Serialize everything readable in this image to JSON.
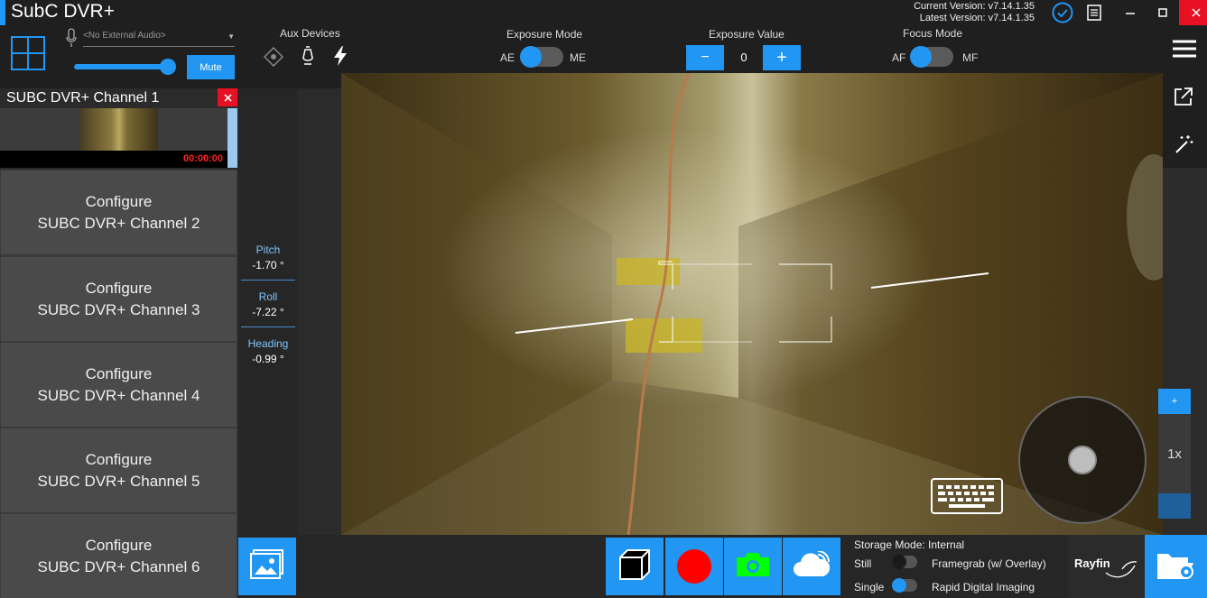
{
  "window": {
    "title": "SubC DVR+",
    "current_version": "Current Version: v7.14.1.35",
    "latest_version": "Latest Version: v7.14.1.35"
  },
  "toolbar": {
    "audio_source": "<No External Audio>",
    "mute_label": "Mute",
    "audio_level": 0.95,
    "aux_devices_label": "Aux Devices",
    "exposure_mode_label": "Exposure Mode",
    "exposure_mode_left": "AE",
    "exposure_mode_right": "ME",
    "exposure_value_label": "Exposure Value",
    "exposure_minus": "−",
    "exposure_plus": "+",
    "exposure_value": "0",
    "focus_mode_label": "Focus Mode",
    "focus_mode_left": "AF",
    "focus_mode_right": "MF"
  },
  "channels": {
    "active": {
      "name": "SUBC DVR+ Channel 1",
      "timer": "00:00:00"
    },
    "configure": [
      {
        "line1": "Configure",
        "line2": "SUBC DVR+ Channel 2"
      },
      {
        "line1": "Configure",
        "line2": "SUBC DVR+ Channel 3"
      },
      {
        "line1": "Configure",
        "line2": "SUBC DVR+ Channel 4"
      },
      {
        "line1": "Configure",
        "line2": "SUBC DVR+ Channel 5"
      },
      {
        "line1": "Configure",
        "line2": "SUBC DVR+ Channel 6"
      }
    ]
  },
  "sensors": {
    "pitch_label": "Pitch",
    "pitch_value": "-1.70 °",
    "roll_label": "Roll",
    "roll_value": "-7.22 °",
    "heading_label": "Heading",
    "heading_value": "-0.99 °"
  },
  "zoom": {
    "plus": "+",
    "level": "1x"
  },
  "bottombar": {
    "storage_mode": "Storage Mode: Internal",
    "still_label": "Still",
    "framegrab_label": "Framegrab (w/ Overlay)",
    "single_label": "Single",
    "rdi_label": "Rapid Digital Imaging",
    "brand": "Rayfin"
  },
  "colors": {
    "accent": "#2196f3",
    "record": "#ff0000",
    "camera": "#00ff00",
    "close": "#e81123",
    "timer": "#ff2222"
  },
  "icons": [
    "layout-grid-icon",
    "microphone-icon",
    "laser-icon",
    "lamp-icon",
    "flash-icon",
    "menu-icon",
    "external-link-icon",
    "magic-wand-icon",
    "keyboard-icon",
    "joystick-icon",
    "gallery-icon",
    "cube-icon",
    "record-icon",
    "camera-icon",
    "cloud-icon",
    "settings-folder-icon",
    "check-circle-icon",
    "notes-icon",
    "minimize-icon",
    "maximize-icon",
    "close-icon"
  ]
}
